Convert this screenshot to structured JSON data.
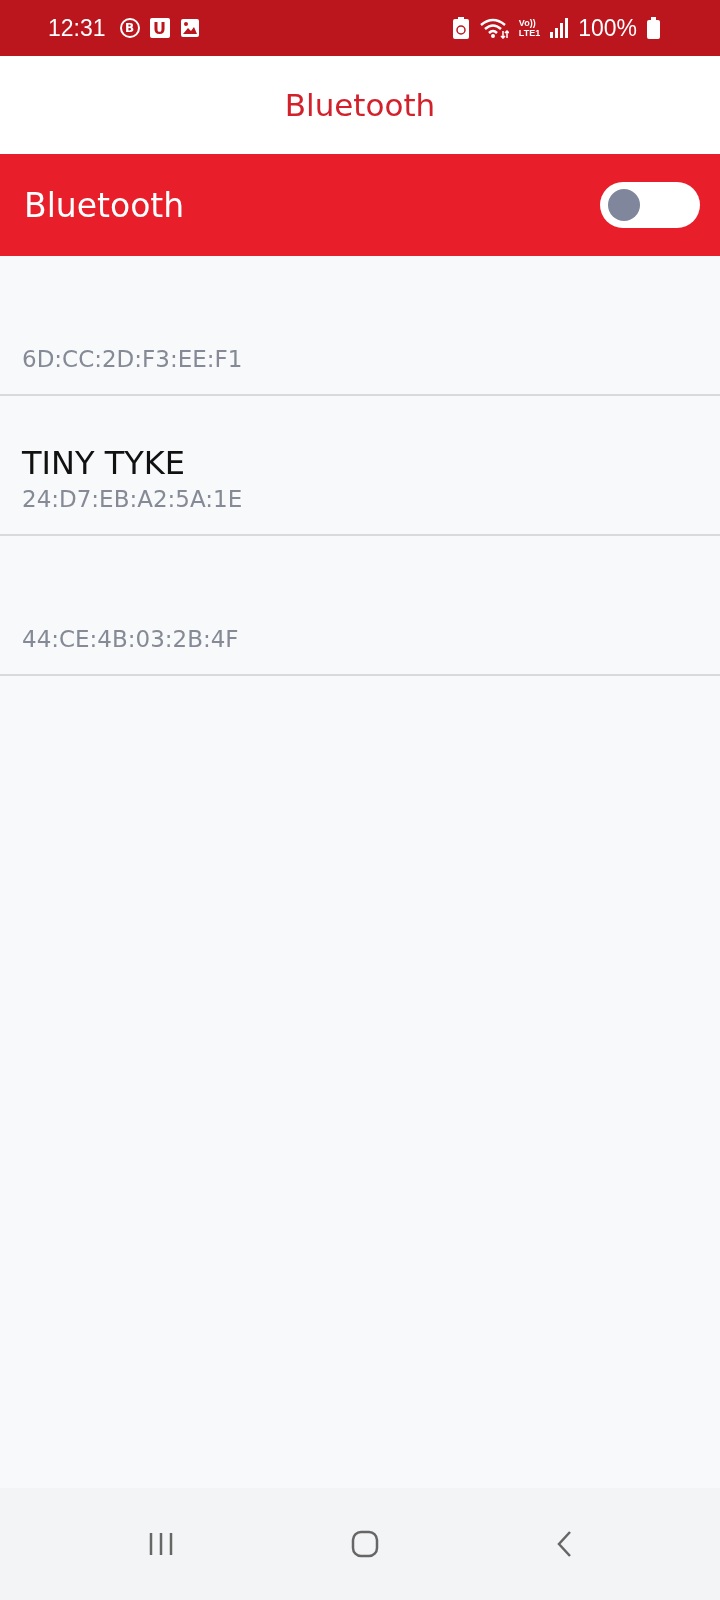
{
  "status_bar": {
    "time": "12:31",
    "notifications": [
      {
        "kind": "circle",
        "glyph": "B"
      },
      {
        "kind": "square",
        "glyph": "U"
      },
      {
        "kind": "image"
      }
    ],
    "network": [
      "Vo))",
      "LTE1"
    ],
    "battery": "100%"
  },
  "header": {
    "title": "Bluetooth"
  },
  "bluetooth_bar": {
    "label": "Bluetooth",
    "on": false
  },
  "devices": [
    {
      "address": "6D:CC:2D:F3:EE:F1"
    },
    {
      "name": "TINY TYKE",
      "address": "24:D7:EB:A2:5A:1E"
    },
    {
      "address": "44:CE:4B:03:2B:4F"
    }
  ]
}
